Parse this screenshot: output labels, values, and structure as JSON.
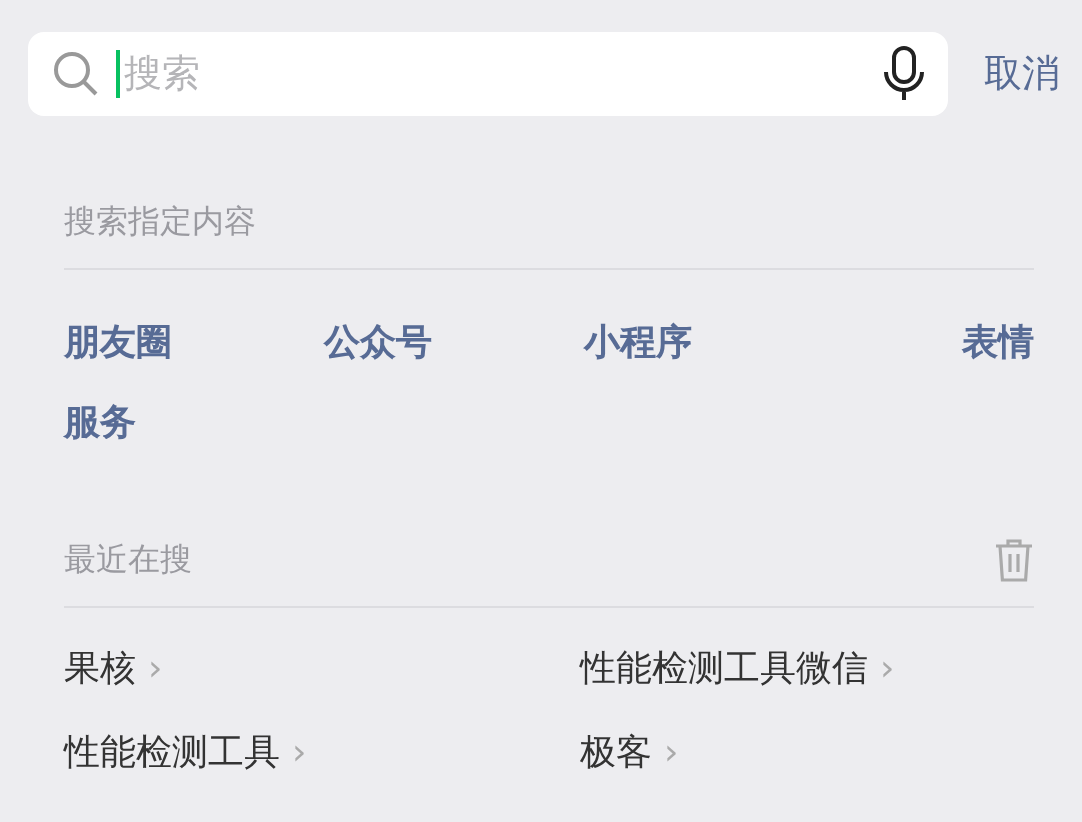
{
  "search": {
    "placeholder": "搜索",
    "cancel": "取消"
  },
  "specified": {
    "title": "搜索指定内容",
    "items": [
      "朋友圈",
      "公众号",
      "小程序",
      "表情",
      "服务"
    ]
  },
  "recent": {
    "title": "最近在搜",
    "items": [
      {
        "label": "果核",
        "arrow": "›"
      },
      {
        "label": "性能检测工具微信",
        "arrow": "›"
      },
      {
        "label": "性能检测工具",
        "arrow": "›"
      },
      {
        "label": "极客",
        "arrow": "›"
      }
    ]
  }
}
